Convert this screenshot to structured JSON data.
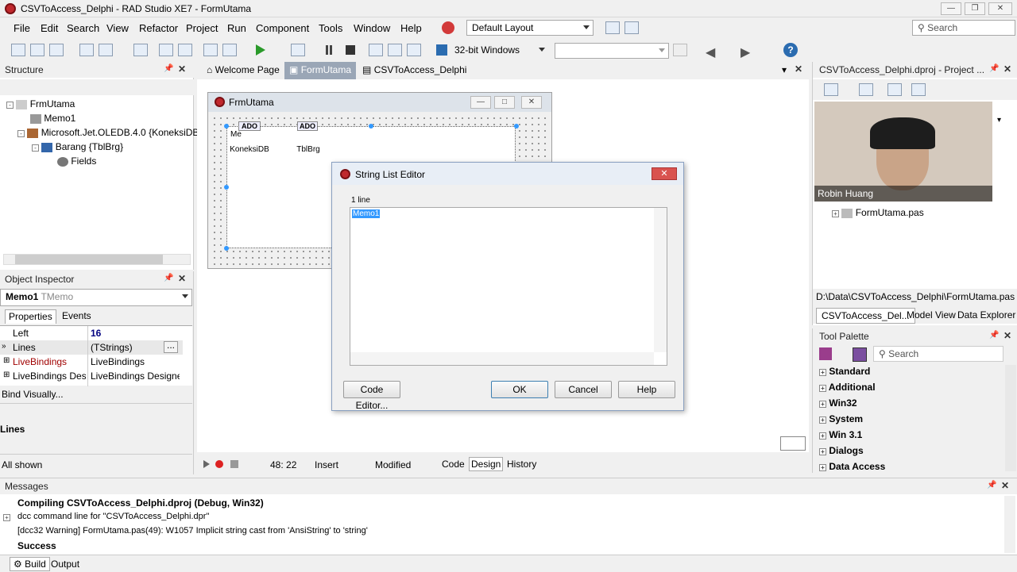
{
  "window": {
    "title": "CSVToAccess_Delphi - RAD Studio XE7 - FormUtama"
  },
  "menu": [
    "File",
    "Edit",
    "Search",
    "View",
    "Refactor",
    "Project",
    "Run",
    "Component",
    "Tools",
    "Window",
    "Help"
  ],
  "toolbar": {
    "layout": "Default Layout",
    "platform": "32-bit Windows",
    "search_placeholder": "Search"
  },
  "structure": {
    "title": "Structure",
    "nodes": [
      "FrmUtama",
      "Memo1",
      "Microsoft.Jet.OLEDB.4.0 {KoneksiDB",
      "Barang {TblBrg}",
      "Fields"
    ]
  },
  "inspector": {
    "title": "Object Inspector",
    "object": "Memo1",
    "object_type": "TMemo",
    "tabs": [
      "Properties",
      "Events"
    ],
    "rows": [
      {
        "name": "Left",
        "value": "16"
      },
      {
        "name": "Lines",
        "value": "(TStrings)"
      },
      {
        "name": "LiveBindings",
        "value": "LiveBindings"
      },
      {
        "name": "LiveBindings Desig",
        "value": "LiveBindings Designe"
      }
    ],
    "bind_link": "Bind Visually...",
    "desc_title": "Lines",
    "footer": "All shown"
  },
  "editor_tabs": [
    "Welcome Page",
    "FormUtama",
    "CSVToAccess_Delphi"
  ],
  "form": {
    "title": "FrmUtama",
    "comp1": {
      "label": "KoneksiDB",
      "icon": "ADO"
    },
    "comp2": {
      "label": "TblBrg",
      "icon": "ADO"
    },
    "memo_text": "Me"
  },
  "dialog": {
    "title": "String List Editor",
    "count": "1 line",
    "content": "Memo1",
    "buttons": {
      "code_editor": "Code Editor...",
      "ok": "OK",
      "cancel": "Cancel",
      "help": "Help"
    }
  },
  "status": {
    "position": "48: 22",
    "mode": "Insert",
    "modified": "Modified",
    "tabs": [
      "Code",
      "Design",
      "History"
    ]
  },
  "project": {
    "title": "CSVToAccess_Delphi.dproj - Project ...",
    "file_node": "FormUtama.pas",
    "path": "D:\\Data\\CSVToAccess_Delphi\\FormUtama.pas",
    "tabs": [
      "CSVToAccess_Del...",
      "Model View",
      "Data Explorer"
    ]
  },
  "webcam": {
    "name": "Robin Huang"
  },
  "palette": {
    "title": "Tool Palette",
    "search_placeholder": "Search",
    "groups": [
      "Standard",
      "Additional",
      "Win32",
      "System",
      "Win 3.1",
      "Dialogs",
      "Data Access"
    ]
  },
  "messages": {
    "title": "Messages",
    "lines": [
      "Compiling CSVToAccess_Delphi.dproj (Debug, Win32)",
      "dcc command line for \"CSVToAccess_Delphi.dpr\"",
      "[dcc32 Warning] FormUtama.pas(49): W1057 Implicit string cast from 'AnsiString' to 'string'",
      "Success"
    ],
    "tabs": [
      "Build",
      "Output"
    ]
  }
}
